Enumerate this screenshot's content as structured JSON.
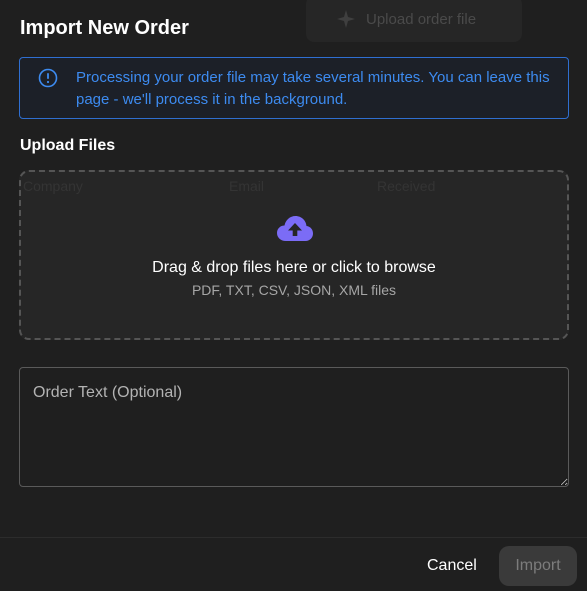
{
  "background": {
    "ghost_button_label": "Upload order file",
    "ghost_table_headers": [
      "Company",
      "Email",
      "Received"
    ]
  },
  "modal": {
    "title": "Import New Order",
    "alert": {
      "icon": "info-icon",
      "message": "Processing your order file may take several minutes. You can leave this page - we'll process it in the background.",
      "color": "#3d8bf0"
    },
    "upload": {
      "section_label": "Upload Files",
      "icon": "cloud-upload-icon",
      "icon_color": "#7b6cf6",
      "prompt": "Drag & drop files here or click to browse",
      "formats": "PDF, TXT, CSV, JSON, XML files"
    },
    "order_text": {
      "placeholder": "Order Text (Optional)",
      "value": ""
    },
    "footer": {
      "cancel_label": "Cancel",
      "import_label": "Import"
    }
  }
}
